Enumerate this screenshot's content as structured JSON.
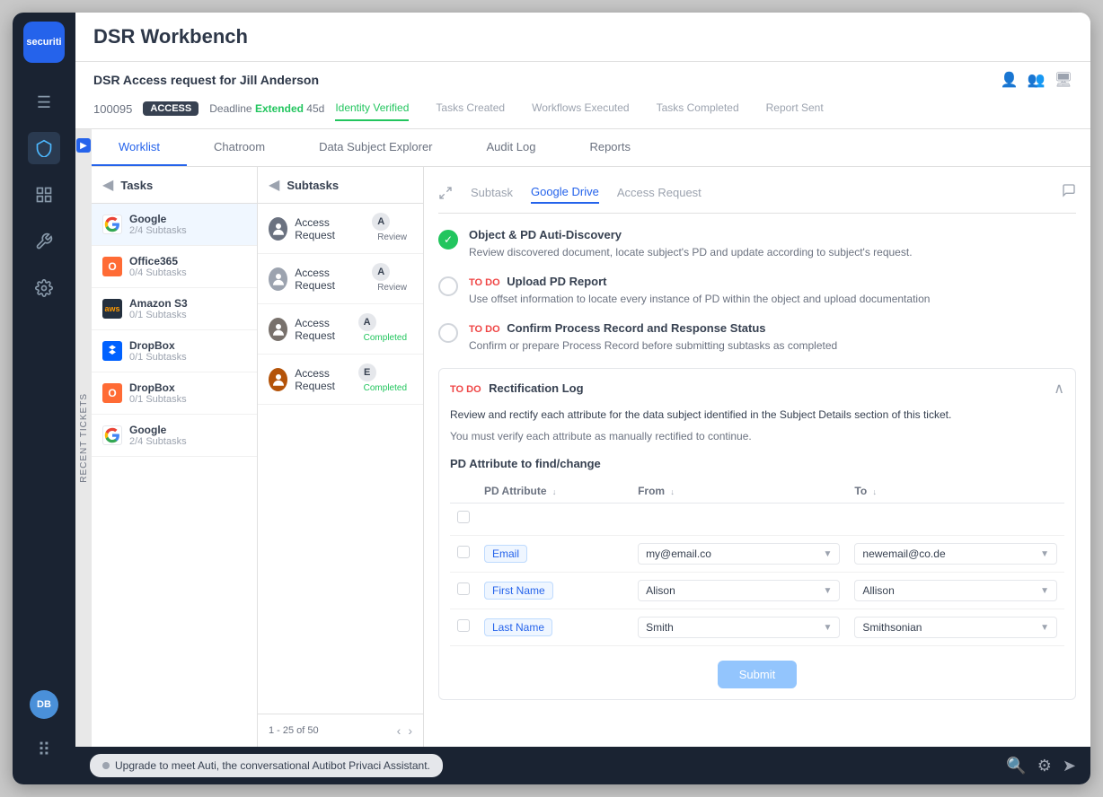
{
  "app": {
    "title": "DSR Workbench",
    "logo": "securiti"
  },
  "sidebar": {
    "menu_icon": "☰",
    "icons": [
      "⊡",
      "⊞",
      "🔧",
      "⚙"
    ],
    "avatar": "DB",
    "dots_icon": "⠿"
  },
  "dsr_header": {
    "title": "DSR Access request for Jill Anderson",
    "ticket_id": "100095",
    "badge": "ACCESS",
    "deadline_label": "Deadline",
    "deadline_status": "Extended",
    "deadline_days": "45d",
    "tabs": [
      {
        "label": "Identity Verified",
        "active": true
      },
      {
        "label": "Tasks Created",
        "active": false
      },
      {
        "label": "Workflows Executed",
        "active": false
      },
      {
        "label": "Tasks Completed",
        "active": false
      },
      {
        "label": "Report Sent",
        "active": false
      }
    ]
  },
  "main_tabs": [
    {
      "label": "Worklist",
      "active": true
    },
    {
      "label": "Chatroom",
      "active": false
    },
    {
      "label": "Data Subject Explorer",
      "active": false
    },
    {
      "label": "Audit Log",
      "active": false
    },
    {
      "label": "Reports",
      "active": false
    }
  ],
  "tasks": {
    "title": "Tasks",
    "items": [
      {
        "name": "Google",
        "subtasks": "2/4 Subtasks",
        "logo": "G",
        "active": true
      },
      {
        "name": "Office365",
        "subtasks": "0/4 Subtasks",
        "logo": "O"
      },
      {
        "name": "Amazon S3",
        "subtasks": "0/1 Subtasks",
        "logo": "aws"
      },
      {
        "name": "DropBox",
        "subtasks": "0/1 Subtasks",
        "logo": "D"
      },
      {
        "name": "DropBox",
        "subtasks": "0/1 Subtasks",
        "logo": "D"
      },
      {
        "name": "Google",
        "subtasks": "2/4 Subtasks",
        "logo": "G"
      }
    ]
  },
  "subtasks": {
    "title": "Subtasks",
    "items": [
      {
        "name": "Access Request",
        "status": "Review",
        "type": "A"
      },
      {
        "name": "Access Request",
        "status": "Review",
        "type": "A"
      },
      {
        "name": "Access Request",
        "status": "Completed",
        "type": "A"
      },
      {
        "name": "Access Request",
        "status": "Completed",
        "type": "E"
      }
    ],
    "pagination": "1 - 25 of 50"
  },
  "detail": {
    "tabs": [
      {
        "label": "Subtask",
        "active": false
      },
      {
        "label": "Google Drive",
        "active": true
      },
      {
        "label": "Access Request",
        "active": false
      }
    ],
    "tasks": [
      {
        "completed": true,
        "title": "Object & PD Auti-Discovery",
        "description": "Review discovered document, locate subject's PD and update according to subject's request."
      },
      {
        "completed": false,
        "todo": true,
        "title": "Upload PD Report",
        "description": "Use offset information to locate every instance of PD within the object and upload documentation"
      },
      {
        "completed": false,
        "todo": true,
        "title": "Confirm Process Record and Response Status",
        "description": "Confirm or prepare Process Record before submitting subtasks as completed"
      }
    ],
    "rectification": {
      "todo_label": "TO DO",
      "title": "Rectification Log",
      "description": "Review and rectify each attribute for the data subject identified in the Subject Details section of this ticket.",
      "note": "You must verify each attribute as manually rectified to continue.",
      "pd_section": "PD Attribute to find/change",
      "table": {
        "headers": [
          {
            "label": ""
          },
          {
            "label": "PD Attribute",
            "sort": "↓"
          },
          {
            "label": "From",
            "sort": "↓"
          },
          {
            "label": "To",
            "sort": "↓"
          }
        ],
        "rows": [
          {
            "attribute": "Email",
            "from": "my@email.co",
            "to": "newemail@co.de"
          },
          {
            "attribute": "First Name",
            "from": "Alison",
            "to": "Allison"
          },
          {
            "attribute": "Last Name",
            "from": "Smith",
            "to": "Smithsonian"
          }
        ]
      },
      "submit_label": "Submit"
    }
  },
  "bottom_bar": {
    "chat_message": "Upgrade to meet Auti, the conversational Autibot Privaci Assistant."
  },
  "recent_tickets_label": "RECENT TICKETS"
}
